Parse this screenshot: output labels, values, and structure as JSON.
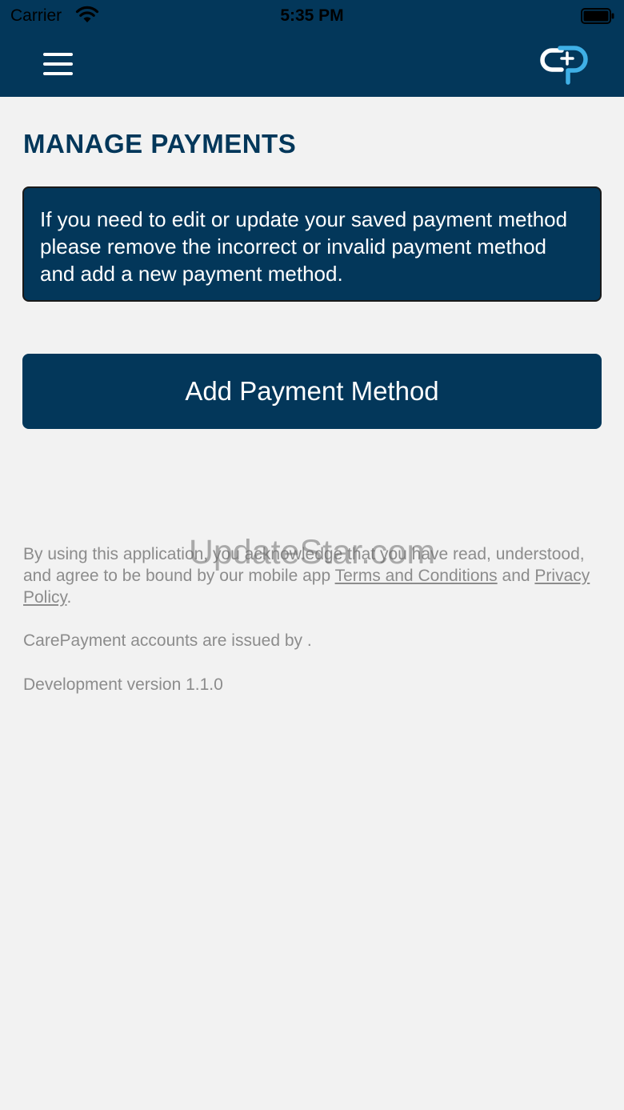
{
  "status_bar": {
    "carrier": "Carrier",
    "time": "5:35 PM"
  },
  "header": {
    "background_color": "#03375a",
    "menu_icon": "hamburger-menu-icon",
    "logo_icon": "carepayment-logo-icon"
  },
  "page": {
    "title": "MANAGE PAYMENTS",
    "info_message": "If you need to edit or update your saved payment method please remove the incorrect or invalid payment method and add a new payment method.",
    "add_button_label": "Add Payment Method"
  },
  "footer": {
    "terms_prefix": "By using this application, you acknowledge that you have read, understood, and agree to be bound by our mobile app ",
    "terms_link": "Terms and Conditions",
    "terms_middle": " and ",
    "privacy_link": "Privacy Policy",
    "terms_suffix": ".",
    "issued_by": "CarePayment accounts are issued by .",
    "version": "Development version 1.1.0"
  },
  "watermark": "UpdateStar.com",
  "colors": {
    "brand": "#03375a",
    "background": "#f2f2f2",
    "logo_accent": "#3fb0e6",
    "muted_text": "#8c8c8c"
  }
}
